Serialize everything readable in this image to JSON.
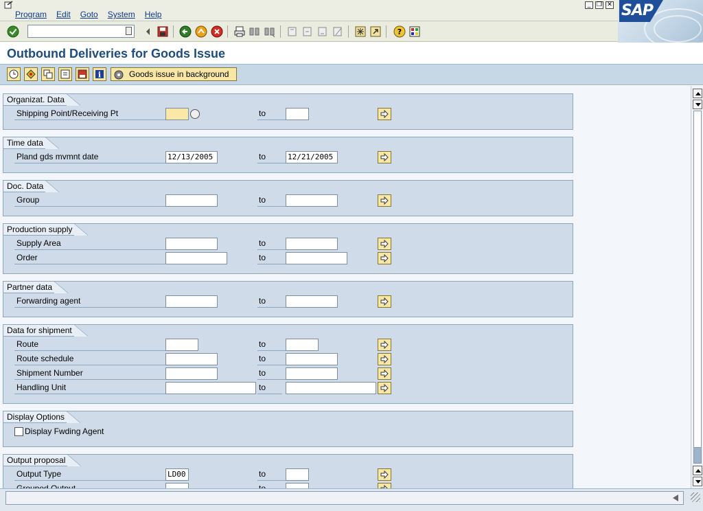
{
  "menu": {
    "items": [
      "Program",
      "Edit",
      "Goto",
      "System",
      "Help"
    ]
  },
  "logo": {
    "text": "SAP"
  },
  "title": "Outbound Deliveries for Goods Issue",
  "app_toolbar": {
    "goods_issue_label": "Goods issue in background"
  },
  "command_field": {
    "value": ""
  },
  "to_label": "to",
  "groups": {
    "org": {
      "title": "Organizat. Data",
      "shipping_point": {
        "label": "Shipping Point/Receiving Pt",
        "from": "",
        "to": ""
      }
    },
    "time": {
      "title": "Time data",
      "pland_gds": {
        "label": "Pland gds mvmnt date",
        "from": "12/13/2005",
        "to": "12/21/2005"
      }
    },
    "doc": {
      "title": "Doc. Data",
      "group": {
        "label": "Group",
        "from": "",
        "to": ""
      }
    },
    "prod": {
      "title": "Production supply",
      "supply_area": {
        "label": "Supply Area",
        "from": "",
        "to": ""
      },
      "order": {
        "label": "Order",
        "from": "",
        "to": ""
      }
    },
    "partner": {
      "title": "Partner data",
      "fwd_agent": {
        "label": "Forwarding agent",
        "from": "",
        "to": ""
      }
    },
    "shipment": {
      "title": "Data for shipment",
      "route": {
        "label": "Route",
        "from": "",
        "to": ""
      },
      "route_schedule": {
        "label": "Route schedule",
        "from": "",
        "to": ""
      },
      "shipment_number": {
        "label": "Shipment Number",
        "from": "",
        "to": ""
      },
      "handling_unit": {
        "label": "Handling Unit",
        "from": "",
        "to": ""
      }
    },
    "display": {
      "title": "Display Options",
      "display_fwding": {
        "label": "Display Fwding Agent",
        "checked": false
      }
    },
    "output": {
      "title": "Output proposal",
      "output_type": {
        "label": "Output Type",
        "from": "LD00",
        "to": ""
      },
      "grouped_output": {
        "label": "Grouped Output",
        "from": "",
        "to": ""
      }
    }
  },
  "status": {
    "message": ""
  }
}
